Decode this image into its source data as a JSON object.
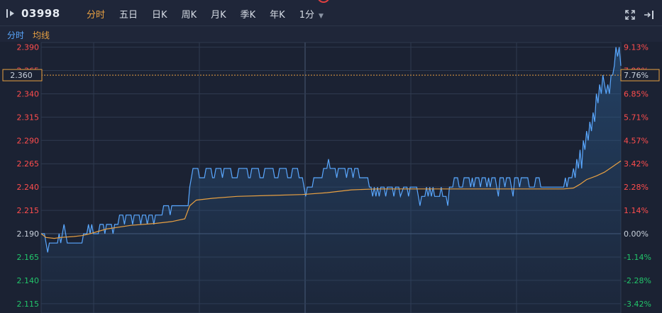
{
  "toolbar": {
    "symbol": "03998",
    "tabs": [
      {
        "label": "分时",
        "active": true
      },
      {
        "label": "五日",
        "active": false
      },
      {
        "label": "日K",
        "active": false
      },
      {
        "label": "周K",
        "active": false
      },
      {
        "label": "月K",
        "active": false
      },
      {
        "label": "季K",
        "active": false
      },
      {
        "label": "年K",
        "active": false
      },
      {
        "label": "1分",
        "active": false,
        "dropdown": true
      }
    ],
    "icons": [
      "collapse-left-icon",
      "fullscreen-icon",
      "exit-panel-icon"
    ]
  },
  "legend": {
    "price_label": "分时",
    "avg_label": "均线"
  },
  "colors": {
    "background": "#1b2233",
    "grid": "#2f3a4f",
    "price_line": "#5aa8ff",
    "avg_line": "#e8a042",
    "up": "#ff4d4d",
    "down": "#22c46a",
    "neutral": "#c9d1dc",
    "crosshair": "#e8a042"
  },
  "chart_data": {
    "type": "line",
    "y_ticks": [
      "2.390",
      "2.365",
      "2.340",
      "2.315",
      "2.290",
      "2.265",
      "2.240",
      "2.215",
      "2.190",
      "2.165",
      "2.140",
      "2.115"
    ],
    "y_tick_values": [
      2.39,
      2.365,
      2.34,
      2.315,
      2.29,
      2.265,
      2.24,
      2.215,
      2.19,
      2.165,
      2.14,
      2.115
    ],
    "pct_ticks": [
      "9.13%",
      "7.99%",
      "6.85%",
      "5.71%",
      "4.57%",
      "3.42%",
      "2.28%",
      "1.14%",
      "0.00%",
      "-1.14%",
      "-2.28%",
      "-3.42%"
    ],
    "pct_tick_values": [
      9.13,
      7.99,
      6.85,
      5.71,
      4.57,
      3.42,
      2.28,
      1.14,
      0.0,
      -1.14,
      -2.28,
      -3.42
    ],
    "ylim": [
      2.105,
      2.395
    ],
    "prev_close": 2.19,
    "crosshair": {
      "price": "2.360",
      "pct": "7.76%"
    },
    "n_points": 331,
    "series": [
      {
        "name": "分时",
        "points": [
          [
            0,
            2.19
          ],
          [
            2,
            2.19
          ],
          [
            3,
            2.18
          ],
          [
            4,
            2.17
          ],
          [
            5,
            2.18
          ],
          [
            10,
            2.18
          ],
          [
            11,
            2.19
          ],
          [
            12,
            2.18
          ],
          [
            13,
            2.19
          ],
          [
            14,
            2.2
          ],
          [
            15,
            2.19
          ],
          [
            16,
            2.18
          ],
          [
            25,
            2.18
          ],
          [
            26,
            2.19
          ],
          [
            28,
            2.19
          ],
          [
            29,
            2.2
          ],
          [
            30,
            2.19
          ],
          [
            31,
            2.2
          ],
          [
            32,
            2.19
          ],
          [
            35,
            2.19
          ],
          [
            36,
            2.2
          ],
          [
            38,
            2.2
          ],
          [
            39,
            2.19
          ],
          [
            40,
            2.2
          ],
          [
            43,
            2.2
          ],
          [
            44,
            2.19
          ],
          [
            45,
            2.2
          ],
          [
            47,
            2.2
          ],
          [
            48,
            2.21
          ],
          [
            50,
            2.21
          ],
          [
            51,
            2.2
          ],
          [
            52,
            2.21
          ],
          [
            55,
            2.21
          ],
          [
            56,
            2.2
          ],
          [
            57,
            2.21
          ],
          [
            60,
            2.21
          ],
          [
            61,
            2.2
          ],
          [
            62,
            2.21
          ],
          [
            64,
            2.21
          ],
          [
            65,
            2.2
          ],
          [
            66,
            2.21
          ],
          [
            68,
            2.21
          ],
          [
            69,
            2.2
          ],
          [
            70,
            2.21
          ],
          [
            74,
            2.21
          ],
          [
            75,
            2.22
          ],
          [
            78,
            2.22
          ],
          [
            79,
            2.21
          ],
          [
            80,
            2.22
          ],
          [
            90,
            2.22
          ],
          [
            91,
            2.24
          ],
          [
            92,
            2.25
          ],
          [
            93,
            2.26
          ],
          [
            96,
            2.26
          ],
          [
            97,
            2.25
          ],
          [
            100,
            2.25
          ],
          [
            101,
            2.26
          ],
          [
            104,
            2.26
          ],
          [
            105,
            2.25
          ],
          [
            106,
            2.25
          ],
          [
            107,
            2.26
          ],
          [
            110,
            2.26
          ],
          [
            111,
            2.25
          ],
          [
            112,
            2.26
          ],
          [
            116,
            2.26
          ],
          [
            117,
            2.25
          ],
          [
            120,
            2.25
          ],
          [
            121,
            2.26
          ],
          [
            126,
            2.26
          ],
          [
            127,
            2.25
          ],
          [
            128,
            2.25
          ],
          [
            129,
            2.26
          ],
          [
            133,
            2.26
          ],
          [
            134,
            2.25
          ],
          [
            136,
            2.25
          ],
          [
            137,
            2.26
          ],
          [
            142,
            2.26
          ],
          [
            143,
            2.25
          ],
          [
            145,
            2.25
          ],
          [
            146,
            2.26
          ],
          [
            150,
            2.26
          ],
          [
            151,
            2.25
          ],
          [
            153,
            2.25
          ],
          [
            154,
            2.26
          ],
          [
            157,
            2.26
          ],
          [
            158,
            2.25
          ],
          [
            160,
            2.25
          ],
          [
            161,
            2.24
          ],
          [
            162,
            2.23
          ],
          [
            163,
            2.24
          ],
          [
            166,
            2.24
          ],
          [
            167,
            2.25
          ],
          [
            172,
            2.25
          ],
          [
            173,
            2.26
          ],
          [
            175,
            2.26
          ],
          [
            176,
            2.27
          ],
          [
            177,
            2.26
          ],
          [
            180,
            2.26
          ],
          [
            181,
            2.25
          ],
          [
            182,
            2.26
          ],
          [
            186,
            2.26
          ],
          [
            187,
            2.25
          ],
          [
            188,
            2.26
          ],
          [
            190,
            2.26
          ],
          [
            191,
            2.25
          ],
          [
            192,
            2.26
          ],
          [
            194,
            2.26
          ],
          [
            195,
            2.25
          ],
          [
            200,
            2.25
          ],
          [
            201,
            2.24
          ],
          [
            202,
            2.24
          ],
          [
            203,
            2.23
          ],
          [
            204,
            2.24
          ],
          [
            205,
            2.23
          ],
          [
            206,
            2.24
          ],
          [
            207,
            2.23
          ],
          [
            208,
            2.24
          ],
          [
            210,
            2.24
          ],
          [
            211,
            2.23
          ],
          [
            212,
            2.24
          ],
          [
            215,
            2.24
          ],
          [
            216,
            2.23
          ],
          [
            217,
            2.24
          ],
          [
            219,
            2.24
          ],
          [
            220,
            2.23
          ],
          [
            222,
            2.24
          ],
          [
            224,
            2.24
          ],
          [
            225,
            2.23
          ],
          [
            226,
            2.24
          ],
          [
            230,
            2.24
          ],
          [
            231,
            2.23
          ],
          [
            232,
            2.22
          ],
          [
            233,
            2.23
          ],
          [
            235,
            2.23
          ],
          [
            236,
            2.24
          ],
          [
            237,
            2.23
          ],
          [
            238,
            2.24
          ],
          [
            239,
            2.23
          ],
          [
            240,
            2.24
          ],
          [
            241,
            2.23
          ],
          [
            244,
            2.23
          ],
          [
            245,
            2.24
          ],
          [
            246,
            2.23
          ],
          [
            248,
            2.23
          ],
          [
            249,
            2.22
          ],
          [
            250,
            2.24
          ],
          [
            252,
            2.24
          ],
          [
            253,
            2.25
          ],
          [
            255,
            2.25
          ],
          [
            256,
            2.24
          ],
          [
            258,
            2.24
          ],
          [
            259,
            2.25
          ],
          [
            262,
            2.25
          ],
          [
            263,
            2.24
          ],
          [
            264,
            2.25
          ],
          [
            265,
            2.24
          ],
          [
            266,
            2.25
          ],
          [
            268,
            2.25
          ],
          [
            269,
            2.24
          ],
          [
            270,
            2.25
          ],
          [
            272,
            2.25
          ],
          [
            273,
            2.24
          ],
          [
            274,
            2.25
          ],
          [
            275,
            2.24
          ],
          [
            276,
            2.25
          ],
          [
            278,
            2.25
          ],
          [
            279,
            2.24
          ],
          [
            280,
            2.23
          ],
          [
            281,
            2.25
          ],
          [
            283,
            2.25
          ],
          [
            284,
            2.24
          ],
          [
            285,
            2.25
          ],
          [
            287,
            2.25
          ],
          [
            288,
            2.24
          ],
          [
            289,
            2.23
          ],
          [
            290,
            2.25
          ],
          [
            292,
            2.25
          ],
          [
            293,
            2.24
          ],
          [
            294,
            2.25
          ],
          [
            298,
            2.25
          ],
          [
            299,
            2.24
          ],
          [
            302,
            2.24
          ],
          [
            303,
            2.25
          ],
          [
            305,
            2.25
          ],
          [
            306,
            2.24
          ],
          [
            320,
            2.24
          ],
          [
            321,
            2.25
          ],
          [
            322,
            2.24
          ],
          [
            323,
            2.25
          ],
          [
            325,
            2.25
          ],
          [
            326,
            2.26
          ],
          [
            327,
            2.25
          ],
          [
            328,
            2.27
          ],
          [
            329,
            2.26
          ],
          [
            330,
            2.28
          ],
          [
            331,
            2.26
          ],
          [
            332,
            2.29
          ],
          [
            333,
            2.28
          ],
          [
            334,
            2.3
          ],
          [
            335,
            2.29
          ],
          [
            336,
            2.31
          ],
          [
            337,
            2.3
          ],
          [
            338,
            2.32
          ],
          [
            339,
            2.31
          ],
          [
            340,
            2.34
          ],
          [
            341,
            2.33
          ],
          [
            342,
            2.35
          ],
          [
            343,
            2.34
          ],
          [
            344,
            2.36
          ],
          [
            345,
            2.35
          ],
          [
            346,
            2.34
          ],
          [
            347,
            2.35
          ],
          [
            348,
            2.34
          ],
          [
            349,
            2.36
          ],
          [
            350,
            2.36
          ],
          [
            351,
            2.37
          ],
          [
            352,
            2.39
          ],
          [
            353,
            2.38
          ],
          [
            354,
            2.39
          ],
          [
            355,
            2.37
          ]
        ]
      },
      {
        "name": "均线",
        "points": [
          [
            0,
            2.19
          ],
          [
            3,
            2.186
          ],
          [
            8,
            2.185
          ],
          [
            12,
            2.186
          ],
          [
            20,
            2.187
          ],
          [
            25,
            2.188
          ],
          [
            30,
            2.19
          ],
          [
            40,
            2.195
          ],
          [
            55,
            2.199
          ],
          [
            70,
            2.201
          ],
          [
            80,
            2.203
          ],
          [
            88,
            2.206
          ],
          [
            91,
            2.22
          ],
          [
            95,
            2.226
          ],
          [
            105,
            2.228
          ],
          [
            120,
            2.23
          ],
          [
            140,
            2.231
          ],
          [
            160,
            2.232
          ],
          [
            175,
            2.234
          ],
          [
            190,
            2.237
          ],
          [
            205,
            2.238
          ],
          [
            230,
            2.238
          ],
          [
            260,
            2.238
          ],
          [
            290,
            2.238
          ],
          [
            320,
            2.238
          ],
          [
            326,
            2.239
          ],
          [
            330,
            2.243
          ],
          [
            334,
            2.248
          ],
          [
            340,
            2.252
          ],
          [
            345,
            2.256
          ],
          [
            350,
            2.262
          ],
          [
            355,
            2.268
          ]
        ]
      }
    ]
  }
}
